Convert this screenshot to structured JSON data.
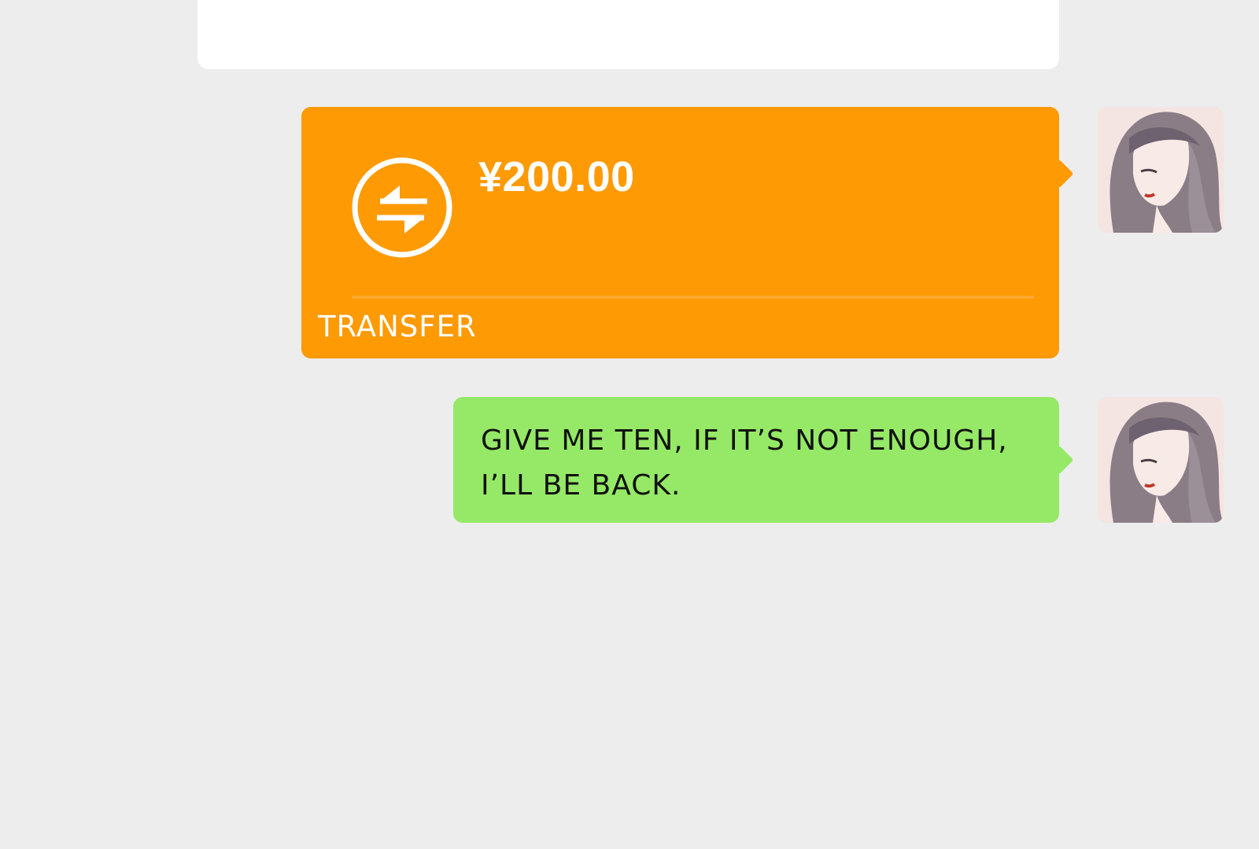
{
  "transfer_message": {
    "amount": "¥200.00",
    "label": "TRANSFER",
    "icon": "transfer-arrows-icon",
    "color": "#fe9a04"
  },
  "text_message": {
    "text": "GIVE ME TEN, IF IT’S NOT ENOUGH,\nI’LL BE BACK.",
    "color": "#95e966"
  },
  "sender": {
    "avatar_icon": "avatar"
  }
}
